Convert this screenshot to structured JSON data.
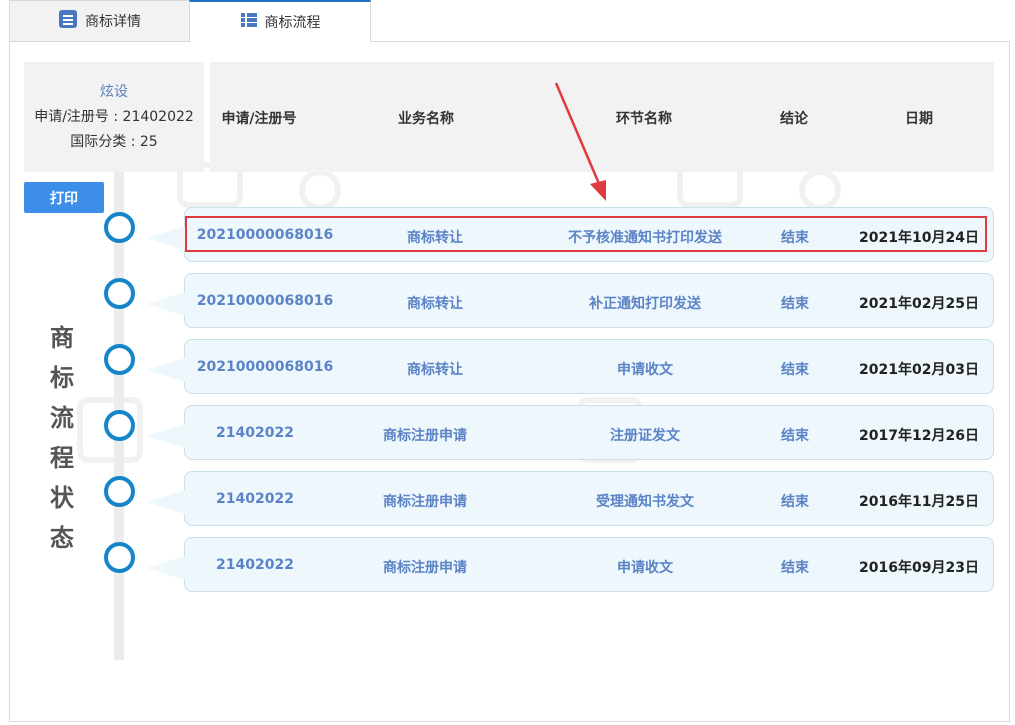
{
  "tabs": [
    {
      "label": "商标详情",
      "icon": "list-doc-icon"
    },
    {
      "label": "商标流程",
      "icon": "list-icon",
      "active": true
    }
  ],
  "info": {
    "mark": "炫设",
    "reg_label": "申请/注册号 : 21402022",
    "class_label": "国际分类 : 25"
  },
  "print_label": "打印",
  "timeline_title": [
    "商",
    "标",
    "流",
    "程",
    "状",
    "态"
  ],
  "columns": [
    "申请/注册号",
    "业务名称",
    "环节名称",
    "结论",
    "日期"
  ],
  "rows": [
    {
      "no": "20210000068016",
      "business": "商标转让",
      "step": "不予核准通知书打印发送",
      "result": "结束",
      "date": "2021年10月24日",
      "highlight": true
    },
    {
      "no": "20210000068016",
      "business": "商标转让",
      "step": "补正通知打印发送",
      "result": "结束",
      "date": "2021年02月25日"
    },
    {
      "no": "20210000068016",
      "business": "商标转让",
      "step": "申请收文",
      "result": "结束",
      "date": "2021年02月03日"
    },
    {
      "no": "21402022",
      "business": "商标注册申请",
      "step": "注册证发文",
      "result": "结束",
      "date": "2017年12月26日"
    },
    {
      "no": "21402022",
      "business": "商标注册申请",
      "step": "受理通知书发文",
      "result": "结束",
      "date": "2016年11月25日"
    },
    {
      "no": "21402022",
      "business": "商标注册申请",
      "step": "申请收文",
      "result": "结束",
      "date": "2016年09月23日"
    }
  ],
  "colors": {
    "accent": "#1686c8",
    "highlight": "#e0393e",
    "button": "#3d8ee9",
    "link": "#5b83c7"
  }
}
